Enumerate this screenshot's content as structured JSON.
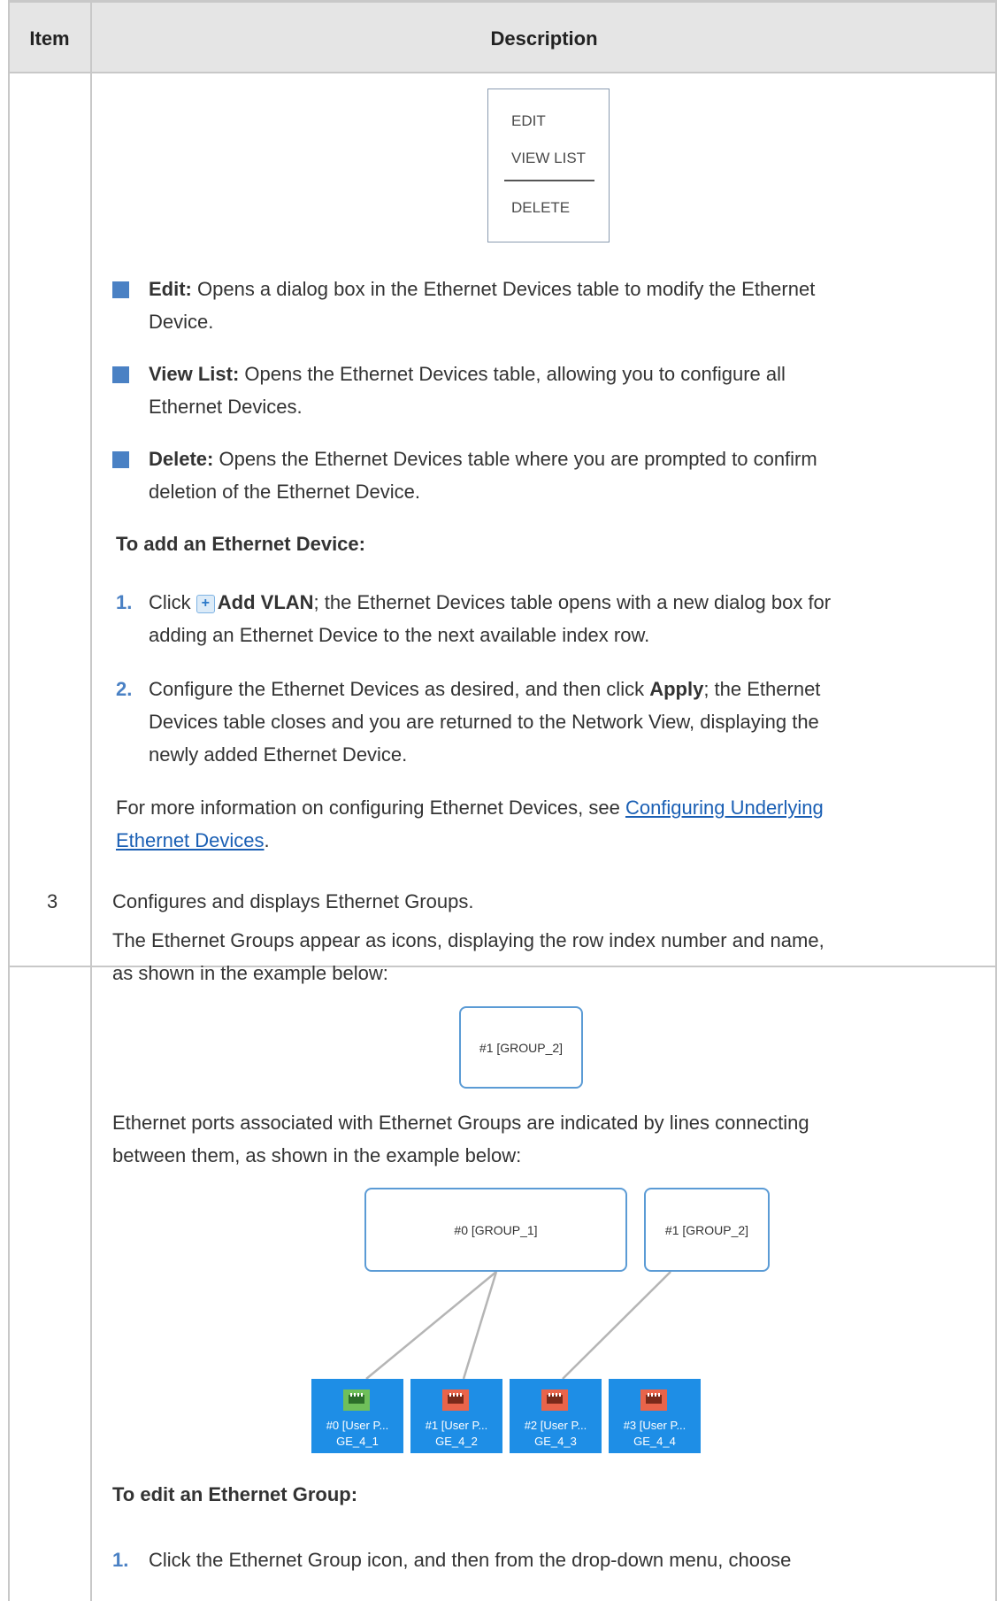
{
  "header": {
    "item": "Item",
    "description": "Description"
  },
  "context_menu": {
    "items": [
      "EDIT",
      "VIEW LIST",
      "DELETE"
    ]
  },
  "bullets": [
    {
      "term": "Edit:",
      "text_l1": " Opens a dialog box in the Ethernet Devices table to modify the Ethernet",
      "text_l2": "Device."
    },
    {
      "term": "View List:",
      "text_l1": " Opens the Ethernet Devices table, allowing you to configure all",
      "text_l2": "Ethernet Devices."
    },
    {
      "term": "Delete:",
      "text_l1": " Opens the Ethernet Devices table where you are prompted to confirm",
      "text_l2": "deletion of the Ethernet Device."
    }
  ],
  "add_device": {
    "heading": "To add an Ethernet Device:",
    "step1": {
      "num": "1.",
      "pre": "Click ",
      "bold": "Add VLAN",
      "post": "; the Ethernet Devices table opens with a new dialog box for",
      "l2": "adding an Ethernet Device to the next available index row."
    },
    "step2": {
      "num": "2.",
      "pre": "Configure the Ethernet Devices as desired, and then click ",
      "bold": "Apply",
      "post": "; the Ethernet",
      "l2": "Devices table closes and you are returned to the Network View, displaying the",
      "l3": "newly added Ethernet Device."
    }
  },
  "more_info": {
    "pre": "For more information on configuring Ethernet Devices, see ",
    "link_l1": "Configuring Underlying",
    "link_l2": "Ethernet Devices",
    "post": "."
  },
  "row3": {
    "item": "3",
    "line1": "Configures and displays Ethernet Groups.",
    "line2": "The Ethernet Groups appear as icons, displaying the row index number and name,",
    "line3": "as shown in the example below:",
    "example_group": "#1 [GROUP_2]",
    "line4": "Ethernet ports associated with Ethernet Groups are indicated by lines connecting",
    "line5": "between them, as shown in the example below:",
    "groups": [
      "#0 [GROUP_1]",
      "#1 [GROUP_2]"
    ],
    "ports": [
      {
        "label": "#0 [User P...",
        "name": "GE_4_1",
        "status_color": "#6fbf5a"
      },
      {
        "label": "#1 [User P...",
        "name": "GE_4_2",
        "status_color": "#e9644a"
      },
      {
        "label": "#2 [User P...",
        "name": "GE_4_3",
        "status_color": "#e9644a"
      },
      {
        "label": "#3 [User P...",
        "name": "GE_4_4",
        "status_color": "#e9644a"
      }
    ],
    "edit_heading": "To edit an Ethernet Group:",
    "edit_step1": {
      "num": "1.",
      "text": "Click the Ethernet Group icon, and then from the drop-down menu, choose"
    }
  },
  "colors": {
    "accent": "#4a81c4",
    "link": "#1a5fb4",
    "port_bg": "#1e8ee6",
    "header_bg": "#e5e5e5"
  }
}
